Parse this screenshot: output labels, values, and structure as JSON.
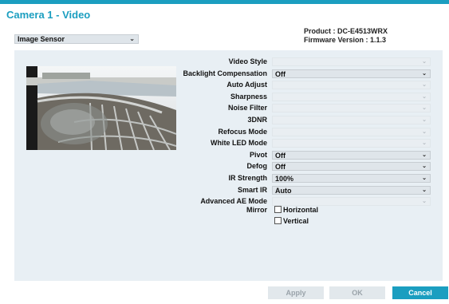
{
  "window": {
    "title": "Camera 1 - Video"
  },
  "device": {
    "product": "Product : DC-E4513WRX",
    "firmware": "Firmware Version : 1.1.3"
  },
  "category_select": {
    "value": "Image Sensor"
  },
  "settings": [
    {
      "label": "Video Style",
      "value": "",
      "enabled": false
    },
    {
      "label": "Backlight Compensation",
      "value": "Off",
      "enabled": true
    },
    {
      "label": "Auto Adjust",
      "value": "",
      "enabled": false
    },
    {
      "label": "Sharpness",
      "value": "",
      "enabled": false
    },
    {
      "label": "Noise Filter",
      "value": "",
      "enabled": false
    },
    {
      "label": "3DNR",
      "value": "",
      "enabled": false
    },
    {
      "label": "Refocus Mode",
      "value": "",
      "enabled": false
    },
    {
      "label": "White LED Mode",
      "value": "",
      "enabled": false
    },
    {
      "label": "Pivot",
      "value": "Off",
      "enabled": true
    },
    {
      "label": "Defog",
      "value": "Off",
      "enabled": true
    },
    {
      "label": "IR Strength",
      "value": "100%",
      "enabled": true
    },
    {
      "label": "Smart IR",
      "value": "Auto",
      "enabled": true
    },
    {
      "label": "Advanced AE Mode",
      "value": "",
      "enabled": false
    }
  ],
  "mirror": {
    "label": "Mirror",
    "horizontal": "Horizontal",
    "vertical": "Vertical"
  },
  "buttons": {
    "apply": "Apply",
    "ok": "OK",
    "cancel": "Cancel"
  },
  "icons": {
    "dropdown": "chevron-down-icon",
    "checkbox": "checkbox-icon"
  },
  "colors": {
    "accent": "#1b9ec0",
    "panel": "#e8eff4"
  }
}
